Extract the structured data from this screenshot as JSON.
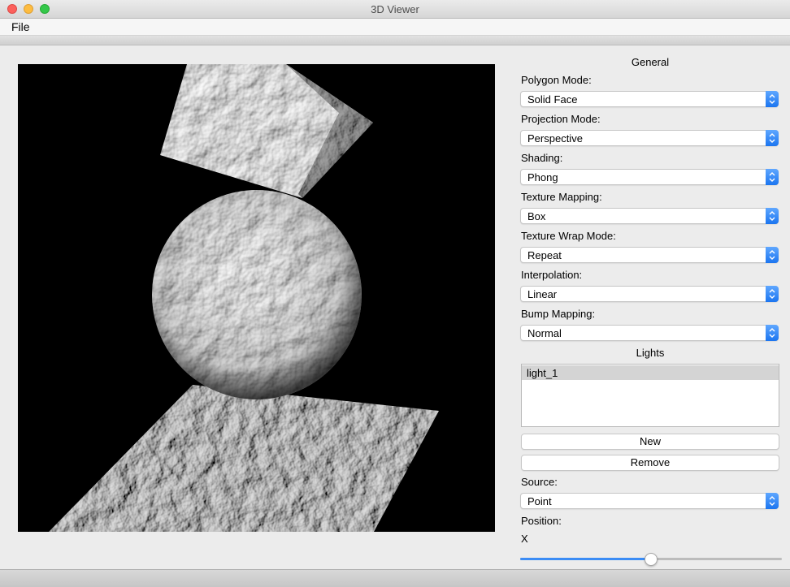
{
  "window": {
    "title": "3D Viewer"
  },
  "menu": {
    "file": "File"
  },
  "general": {
    "title": "General",
    "polygon_mode": {
      "label": "Polygon Mode:",
      "value": "Solid Face"
    },
    "projection_mode": {
      "label": "Projection Mode:",
      "value": "Perspective"
    },
    "shading": {
      "label": "Shading:",
      "value": "Phong"
    },
    "texture_mapping": {
      "label": "Texture Mapping:",
      "value": "Box"
    },
    "texture_wrap_mode": {
      "label": "Texture Wrap Mode:",
      "value": "Repeat"
    },
    "interpolation": {
      "label": "Interpolation:",
      "value": "Linear"
    },
    "bump_mapping": {
      "label": "Bump Mapping:",
      "value": "Normal"
    }
  },
  "lights": {
    "title": "Lights",
    "items": [
      "light_1"
    ],
    "new_label": "New",
    "remove_label": "Remove",
    "source": {
      "label": "Source:",
      "value": "Point"
    },
    "position_label": "Position:",
    "x_label": "X",
    "x_slider_fraction": 0.5
  },
  "colors": {
    "accent": "#1b75f0",
    "viewport_bg": "#000000"
  }
}
